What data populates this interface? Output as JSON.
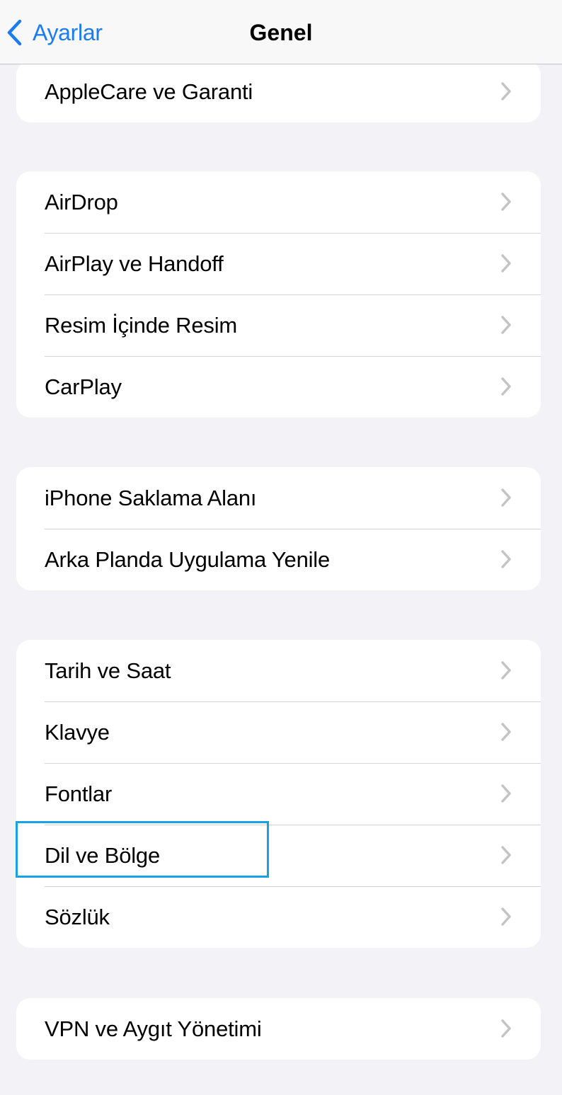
{
  "navbar": {
    "back_label": "Ayarlar",
    "title": "Genel"
  },
  "groups": [
    {
      "items": [
        {
          "label": "AppleCare ve Garanti"
        }
      ]
    },
    {
      "items": [
        {
          "label": "AirDrop"
        },
        {
          "label": "AirPlay ve Handoff"
        },
        {
          "label": "Resim İçinde Resim"
        },
        {
          "label": "CarPlay"
        }
      ]
    },
    {
      "items": [
        {
          "label": "iPhone Saklama Alanı"
        },
        {
          "label": "Arka Planda Uygulama Yenile"
        }
      ]
    },
    {
      "items": [
        {
          "label": "Tarih ve Saat"
        },
        {
          "label": "Klavye"
        },
        {
          "label": "Fontlar"
        },
        {
          "label": "Dil ve Bölge"
        },
        {
          "label": "Sözlük"
        }
      ]
    },
    {
      "items": [
        {
          "label": "VPN ve Aygıt Yönetimi"
        }
      ]
    }
  ],
  "highlighted_item": "Dil ve Bölge",
  "colors": {
    "accent": "#1a7cf0",
    "highlight_box": "#17a2e6",
    "background": "#f2f2f7"
  }
}
